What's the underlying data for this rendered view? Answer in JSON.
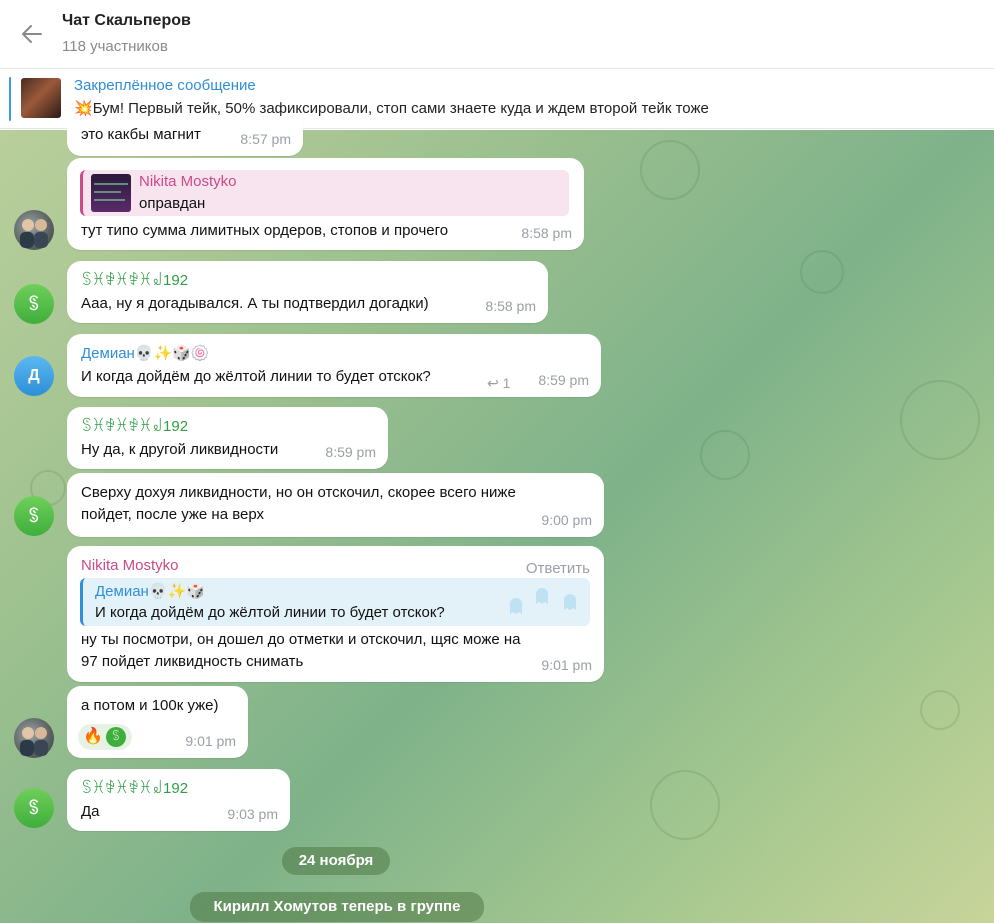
{
  "header": {
    "title": "Чат Скальперов",
    "subtitle": "118 участников"
  },
  "pinned": {
    "title": "Закреплённое сообщение",
    "emoji": "💥",
    "text": "Бум! Первый тейк, 50% зафиксировали, стоп сами знаете куда и ждем второй тейк тоже"
  },
  "messages": {
    "m1": {
      "text": "это какбы магнит",
      "time": "8:57 pm"
    },
    "m2": {
      "quote_author": "Nikita Mostyko",
      "quote_text": "оправдан",
      "text": "тут типо сумма лимитных ордеров, стопов и прочего",
      "time": "8:58 pm"
    },
    "m3": {
      "author": "ꌗꁝꒆꁝꒆꁝ꒻192",
      "text": "Ааа, ну я догадывался. А ты подтвердил догадки)",
      "time": "8:58 pm",
      "avatar": "ꌗ"
    },
    "m4": {
      "author": "Демиан",
      "author_emoji": "💀✨🎲🍥",
      "text": "И когда дойдём до жёлтой линии то будет отскок?",
      "reply_count": "1",
      "time": "8:59 pm",
      "avatar": "Д"
    },
    "m5": {
      "author": "ꌗꁝꒆꁝꒆꁝ꒻192",
      "text": "Ну да, к другой ликвидности",
      "time": "8:59 pm"
    },
    "m6": {
      "line1": "Сверху дохуя ликвидности, но он отскочил, скорее всего ниже",
      "line2": "пойдет, после уже на верх",
      "time": "9:00 pm",
      "avatar": "ꌗ"
    },
    "m7": {
      "author": "Nikita Mostyko",
      "reply_label": "Ответить",
      "quote_author": "Демиан",
      "quote_emoji": "💀✨🎲",
      "quote_text": "И когда дойдём до жёлтой линии то будет отскок?",
      "line1": "ну ты посмотри, он дошел до отметки и отскочил, щяс може на",
      "line2": "97 пойдет ликвидность снимать",
      "time": "9:01 pm"
    },
    "m8": {
      "text": "а потом и 100к уже)",
      "reaction_emoji": "🔥",
      "reaction_avatar": "ꌗ",
      "time": "9:01 pm"
    },
    "m9": {
      "author": "ꌗꁝꒆꁝꒆꁝ꒻192",
      "text": "Да",
      "time": "9:03 pm",
      "avatar": "ꌗ"
    }
  },
  "date_divider": "24 ноября",
  "service_message": "Кирилл Хомутов теперь в группе",
  "colors": {
    "accent": "#2f8fd8",
    "green_name": "#2f9e44",
    "pink_name": "#cc4a86"
  }
}
